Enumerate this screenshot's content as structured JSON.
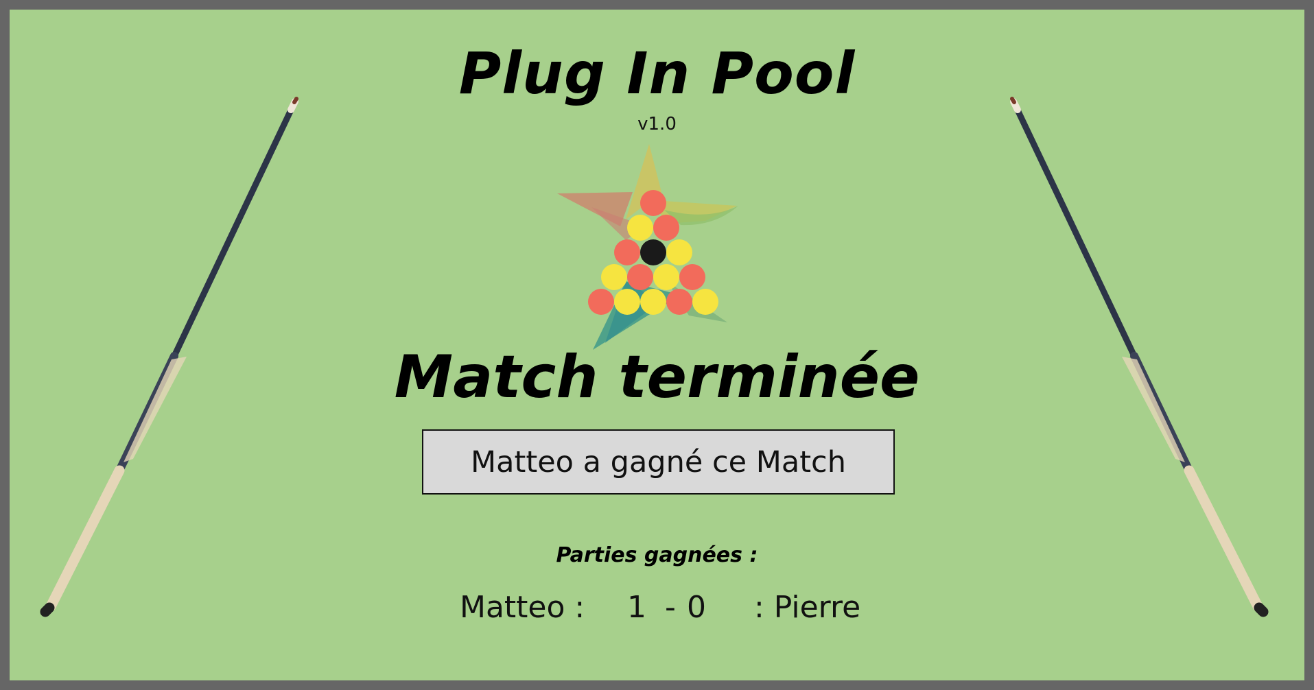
{
  "app": {
    "title": "Plug In Pool",
    "version": "v1.0"
  },
  "result": {
    "heading": "Match terminée",
    "winner_message": "Matteo a gagné ce Match"
  },
  "score": {
    "label": "Parties gagnées :",
    "player1_label": "Matteo :",
    "player1_score": "1",
    "separator": "-",
    "player2_score": "0",
    "player2_label": ": Pierre"
  },
  "colors": {
    "table_felt": "#a7d08c",
    "frame": "#666666",
    "ball_red": "#f26b5b",
    "ball_yellow": "#f6e440",
    "ball_black": "#1a1a1a",
    "winner_box": "#d9d9d9"
  },
  "icons": {
    "logo": "billiard-rack-star-logo",
    "left_cue": "pool-cue-icon",
    "right_cue": "pool-cue-icon"
  }
}
